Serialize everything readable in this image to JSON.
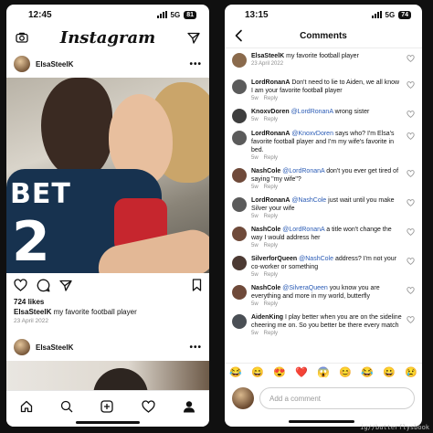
{
  "left": {
    "status": {
      "time": "12:45",
      "network": "5G",
      "battery": "81"
    },
    "header": {
      "logo": "Instagram"
    },
    "post": {
      "username": "ElsaSteelK",
      "photo_text": "BET",
      "photo_number": "2",
      "likes": "724 likes",
      "caption_user": "ElsaSteelK",
      "caption_text": "my favorite football player",
      "date": "23 April 2022"
    },
    "post2": {
      "username": "ElsaSteelK"
    }
  },
  "right": {
    "status": {
      "time": "13:15",
      "network": "5G",
      "battery": "74"
    },
    "header": {
      "title": "Comments"
    },
    "comments": [
      {
        "user": "ElsaSteelK",
        "mention": "",
        "text": "my favorite football player",
        "meta": [
          "23 April 2022"
        ],
        "avatar_color": "#8a6a4c"
      },
      {
        "user": "LordRonanA",
        "mention": "",
        "text": "Don't need to lie to Aiden, we all know I am your favorite football player",
        "meta": [
          "5w",
          "Reply"
        ],
        "avatar_color": "#5b5b5b"
      },
      {
        "user": "KnoxvDoren",
        "mention": "@LordRonanA",
        "text": "wrong sister",
        "meta": [
          "5w",
          "Reply"
        ],
        "avatar_color": "#3e3e3e"
      },
      {
        "user": "LordRonanA",
        "mention": "@KnoxvDoren",
        "text": "says who? I'm Elsa's favorite football player and I'm my wife's favorite in bed.",
        "meta": [
          "5w",
          "Reply"
        ],
        "avatar_color": "#5b5b5b"
      },
      {
        "user": "NashCole",
        "mention": "@LordRonanA",
        "text": "don't you ever get tired of saying \"my wife\"?",
        "meta": [
          "5w",
          "Reply"
        ],
        "avatar_color": "#6f4a3a"
      },
      {
        "user": "LordRonanA",
        "mention": "@NashCole",
        "text": "just wait until you make Silver your wife",
        "meta": [
          "5w",
          "Reply"
        ],
        "avatar_color": "#5b5b5b"
      },
      {
        "user": "NashCole",
        "mention": "@LordRonanA",
        "text": "a title won't change the way I would address her",
        "meta": [
          "5w",
          "Reply"
        ],
        "avatar_color": "#6f4a3a"
      },
      {
        "user": "SilverforQueen",
        "mention": "@NashCole",
        "text": "address? I'm not your co-worker or something",
        "meta": [
          "5w",
          "Reply"
        ],
        "avatar_color": "#4c3a33"
      },
      {
        "user": "NashCole",
        "mention": "@SilveraQueen",
        "text": "you know you are everything and more in my world, butterfly",
        "meta": [
          "5w",
          "Reply"
        ],
        "avatar_color": "#6f4a3a"
      },
      {
        "user": "AidenKing",
        "mention": "",
        "text": "I play better when you are on the sideline cheering me on. So you better be there every match",
        "meta": [
          "5w",
          "Reply"
        ],
        "avatar_color": "#4a4f55"
      }
    ],
    "emoji_bar": [
      "😂",
      "😄",
      "😍",
      "❤️",
      "😱",
      "😊",
      "😂",
      "😀",
      "😢"
    ],
    "add_comment": {
      "placeholder": "Add a comment"
    }
  },
  "watermark": "ig//butterflysbook"
}
